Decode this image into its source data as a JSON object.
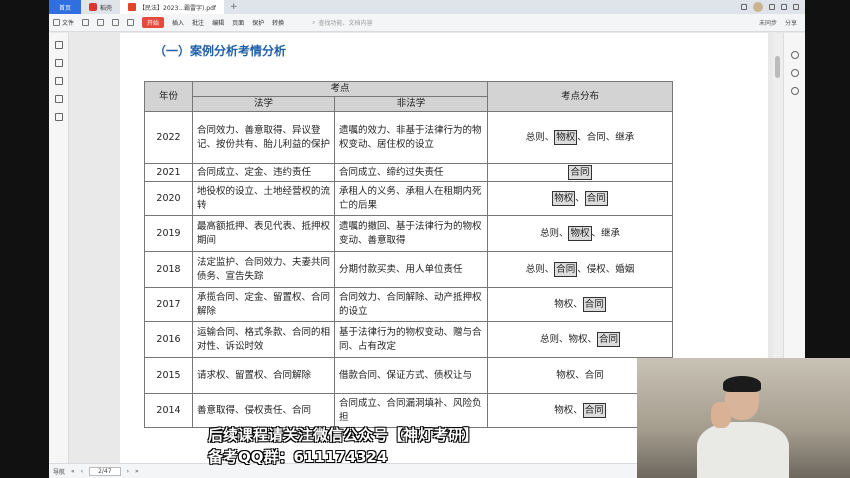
{
  "tabs": [
    {
      "label": "首页"
    },
    {
      "label": "稻壳"
    },
    {
      "label": "【民法】2023...霸雷字).pdf"
    }
  ],
  "toolbar": {
    "file_label": "文件",
    "items": [
      "开始",
      "插入",
      "批注",
      "编辑",
      "页面",
      "保护",
      "转换"
    ],
    "search_placeholder": "查找功能、文档内容",
    "sync_label": "未同步",
    "share_label": "分享"
  },
  "document": {
    "heading": "（一）案例分析考情分析",
    "headers": {
      "year": "年份",
      "exam_points": "考点",
      "law": "法学",
      "non_law": "非法学",
      "distribution": "考点分布"
    },
    "rows": [
      {
        "year": "2022",
        "law": "合同效力、善意取得、异议登记、按份共有、胎儿利益的保护",
        "non": "遗嘱的效力、非基于法律行为的物权变动、居住权的设立",
        "dist": [
          "总则、",
          "[物权]",
          "、合同、继承"
        ]
      },
      {
        "year": "2021",
        "law": "合同成立、定金、违约责任",
        "non": "合同成立、缔约过失责任",
        "dist": [
          "[合同]"
        ]
      },
      {
        "year": "2020",
        "law": "地役权的设立、土地经营权的流转",
        "non": "承租人的义务、承租人在租期内死亡的后果",
        "dist": [
          "[物权]",
          "、",
          "[合同]"
        ]
      },
      {
        "year": "2019",
        "law": "最高额抵押、表见代表、抵押权期间",
        "non": "遗嘱的撤回、基于法律行为的物权变动、善意取得",
        "dist": [
          "总则、",
          "[物权]",
          "、继承"
        ]
      },
      {
        "year": "2018",
        "law": "法定监护、合同效力、夫妻共同债务、宣告失踪",
        "non": "分期付款买卖、用人单位责任",
        "dist": [
          "总则、",
          "[合同]",
          "、侵权、婚姻"
        ]
      },
      {
        "year": "2017",
        "law": "承揽合同、定金、留置权、合同解除",
        "non": "合同效力、合同解除、动产抵押权的设立",
        "dist": [
          "物权、",
          "[合同]"
        ]
      },
      {
        "year": "2016",
        "law": "运输合同、格式条款、合同的相对性、诉讼时效",
        "non": "基于法律行为的物权变动、赠与合同、占有改定",
        "dist": [
          "总则、物权、",
          "[合同]"
        ]
      },
      {
        "year": "2015",
        "law": "请求权、留置权、合同解除",
        "non": "借款合同、保证方式、债权让与",
        "dist": [
          "物权、合同"
        ]
      },
      {
        "year": "2014",
        "law": "善意取得、侵权责任、合同",
        "non": "合同成立、合同漏洞填补、风险负担",
        "dist": [
          "物权、",
          "[合同]"
        ]
      }
    ]
  },
  "captions": {
    "line1": "后续课程请关注微信公众号【神灯考研】",
    "line2": "备考QQ群：611174324"
  },
  "status": {
    "nav_label": "导航",
    "page_indicator": "2/47"
  }
}
